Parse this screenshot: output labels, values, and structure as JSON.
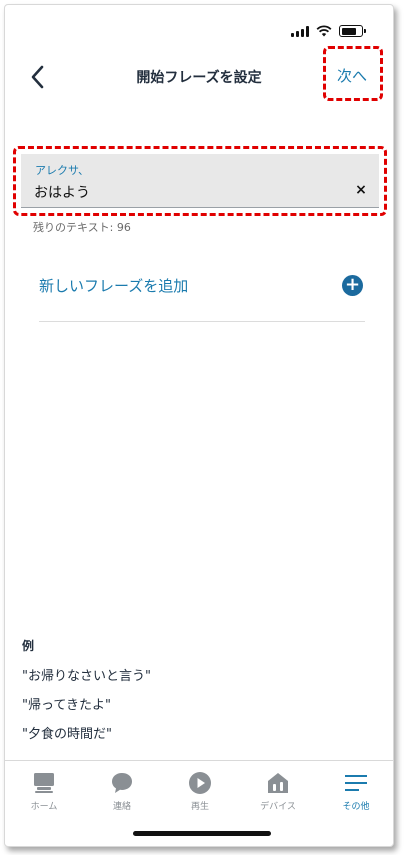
{
  "header": {
    "title": "開始フレーズを設定",
    "next_label": "次へ"
  },
  "input": {
    "label": "アレクサ、",
    "value": "おはよう",
    "clear_glyph": "×"
  },
  "remaining_text": "残りのテキスト: 96",
  "add_phrase": {
    "label": "新しいフレーズを追加",
    "plus_glyph": "+"
  },
  "examples": {
    "heading": "例",
    "items": [
      "\"お帰りなさいと言う\"",
      "\"帰ってきたよ\"",
      "\"夕食の時間だ\""
    ]
  },
  "tabs": [
    {
      "label": "ホーム",
      "icon": "home-icon",
      "active": false
    },
    {
      "label": "連絡",
      "icon": "chat-bubble-icon",
      "active": false
    },
    {
      "label": "再生",
      "icon": "play-icon",
      "active": false
    },
    {
      "label": "デバイス",
      "icon": "devices-house-icon",
      "active": false
    },
    {
      "label": "その他",
      "icon": "menu-icon",
      "active": true
    }
  ],
  "colors": {
    "accent": "#1b7bae",
    "highlight_dashes": "#e00000",
    "input_background": "#e8e8e8",
    "inactive_tab": "#8a8f94"
  }
}
